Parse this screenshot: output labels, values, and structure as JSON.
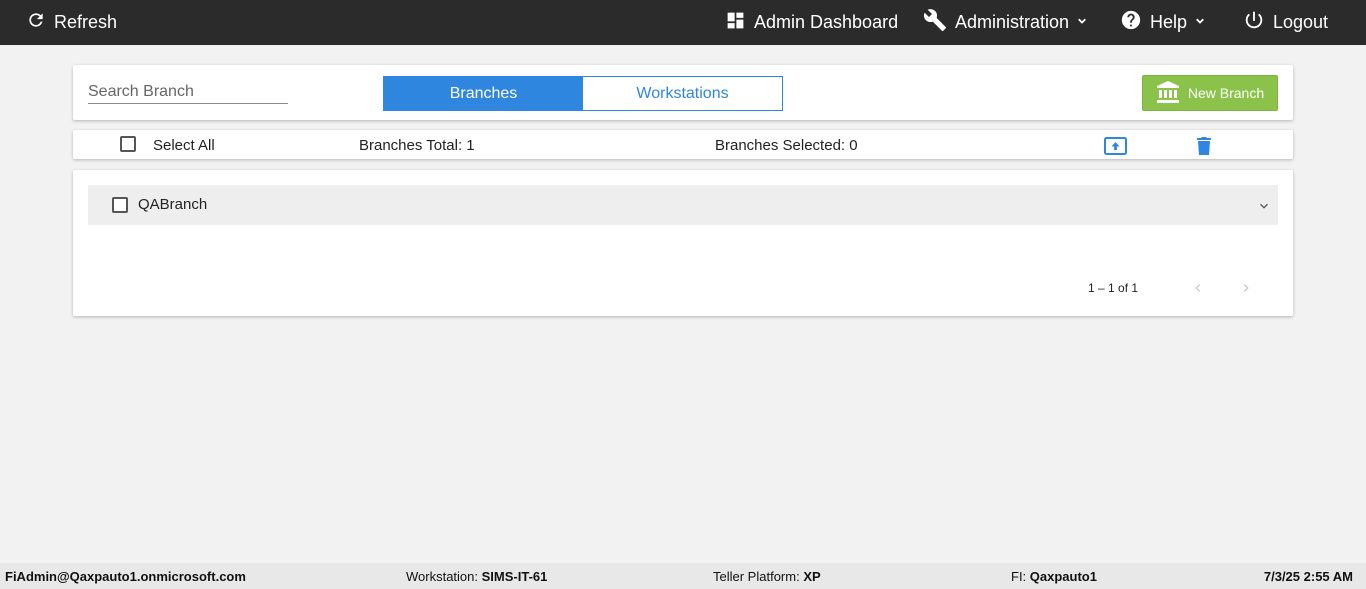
{
  "topbar": {
    "refresh": "Refresh",
    "admin_dashboard": "Admin Dashboard",
    "administration": "Administration",
    "help": "Help",
    "logout": "Logout"
  },
  "search": {
    "placeholder": "Search Branch",
    "value": ""
  },
  "tabs": [
    {
      "label": "Branches",
      "active": true
    },
    {
      "label": "Workstations",
      "active": false
    }
  ],
  "new_branch_label": "New Branch",
  "select_bar": {
    "select_all": "Select All",
    "branches_total": "Branches Total: 1",
    "branches_selected": "Branches Selected: 0"
  },
  "branches": [
    {
      "name": "QABranch",
      "checked": false
    }
  ],
  "pagination": {
    "range": "1 – 1 of 1"
  },
  "footer": {
    "user": "FiAdmin@Qaxpauto1.onmicrosoft.com",
    "workstation_label": "Workstation:",
    "workstation_value": "SIMS-IT-61",
    "platform_label": "Teller Platform:",
    "platform_value": "XP",
    "fi_label": "FI:",
    "fi_value": "Qaxpauto1",
    "datetime": "7/3/25 2:55 AM"
  },
  "colors": {
    "topbar": "#2b2b2b",
    "primary": "#2e86de",
    "success": "#8bc34a",
    "background": "#f2f2f2"
  },
  "icons": [
    "refresh-icon",
    "dashboard-icon",
    "wrench-icon",
    "help-icon",
    "power-icon",
    "bank-icon",
    "upload-icon",
    "trash-icon",
    "chevron-down-icon",
    "chevron-left-icon",
    "chevron-right-icon"
  ]
}
